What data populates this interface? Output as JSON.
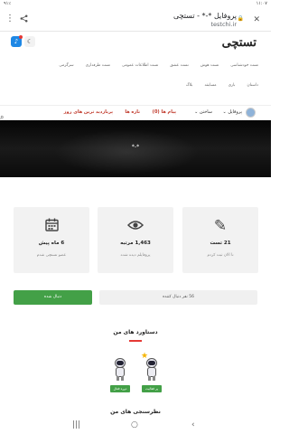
{
  "status_bar": {
    "time": "۱۱:۰۷",
    "left_text": "۹۱٪"
  },
  "browser": {
    "page_title": "پروفایل *-* - تستچی",
    "url": "testchi.ir",
    "close_icon": "close-icon",
    "lock_icon": "lock-icon",
    "share_icon": "share-icon",
    "menu_icon": "more-vert-icon"
  },
  "site": {
    "logo": "تستچی",
    "nav_row1": [
      "تست خودشناسی",
      "تست هوش",
      "تست عشق",
      "تست اطلاعات عمومی",
      "تست طرفداری",
      "سرگرمی"
    ],
    "nav_row2": [
      "داستان",
      "بازی",
      "مسابقه",
      "بلاگ"
    ]
  },
  "menu": {
    "profile_label": "پروفایل",
    "my_tests_label": "ساختن",
    "messages_label": "پیام ها (0)",
    "top_tests_label": "تازه ها",
    "trending_label": "پربازدید ترین های روز"
  },
  "profile": {
    "nickname": "*-*"
  },
  "stats": [
    {
      "icon": "pencil-icon",
      "value": "21 تست",
      "caption": "تا الان ثبت کردم"
    },
    {
      "icon": "eye-icon",
      "value": "1,463 مرتبه",
      "caption": "پروفایلم دیده شده"
    },
    {
      "icon": "calendar-icon",
      "value": "6 ماه پیش",
      "caption": "عضو تستچی شدم"
    }
  ],
  "follow": {
    "button_label": "دنبال شده",
    "followers_text": "56 نفر دنبال کننده"
  },
  "achievements": {
    "title": "دستاورد های من",
    "badges": [
      {
        "label": "دوره فعال"
      },
      {
        "label": "پر فعالیت"
      }
    ]
  },
  "comments": {
    "title": "نظرسنجی های من"
  },
  "android_nav": {
    "recent_icon": "recent-apps-icon",
    "home_icon": "home-icon",
    "back_icon": "back-icon"
  },
  "colors": {
    "accent_red": "#e53935",
    "green": "#43a047",
    "blue": "#1e88e5",
    "banner": "#111111"
  }
}
